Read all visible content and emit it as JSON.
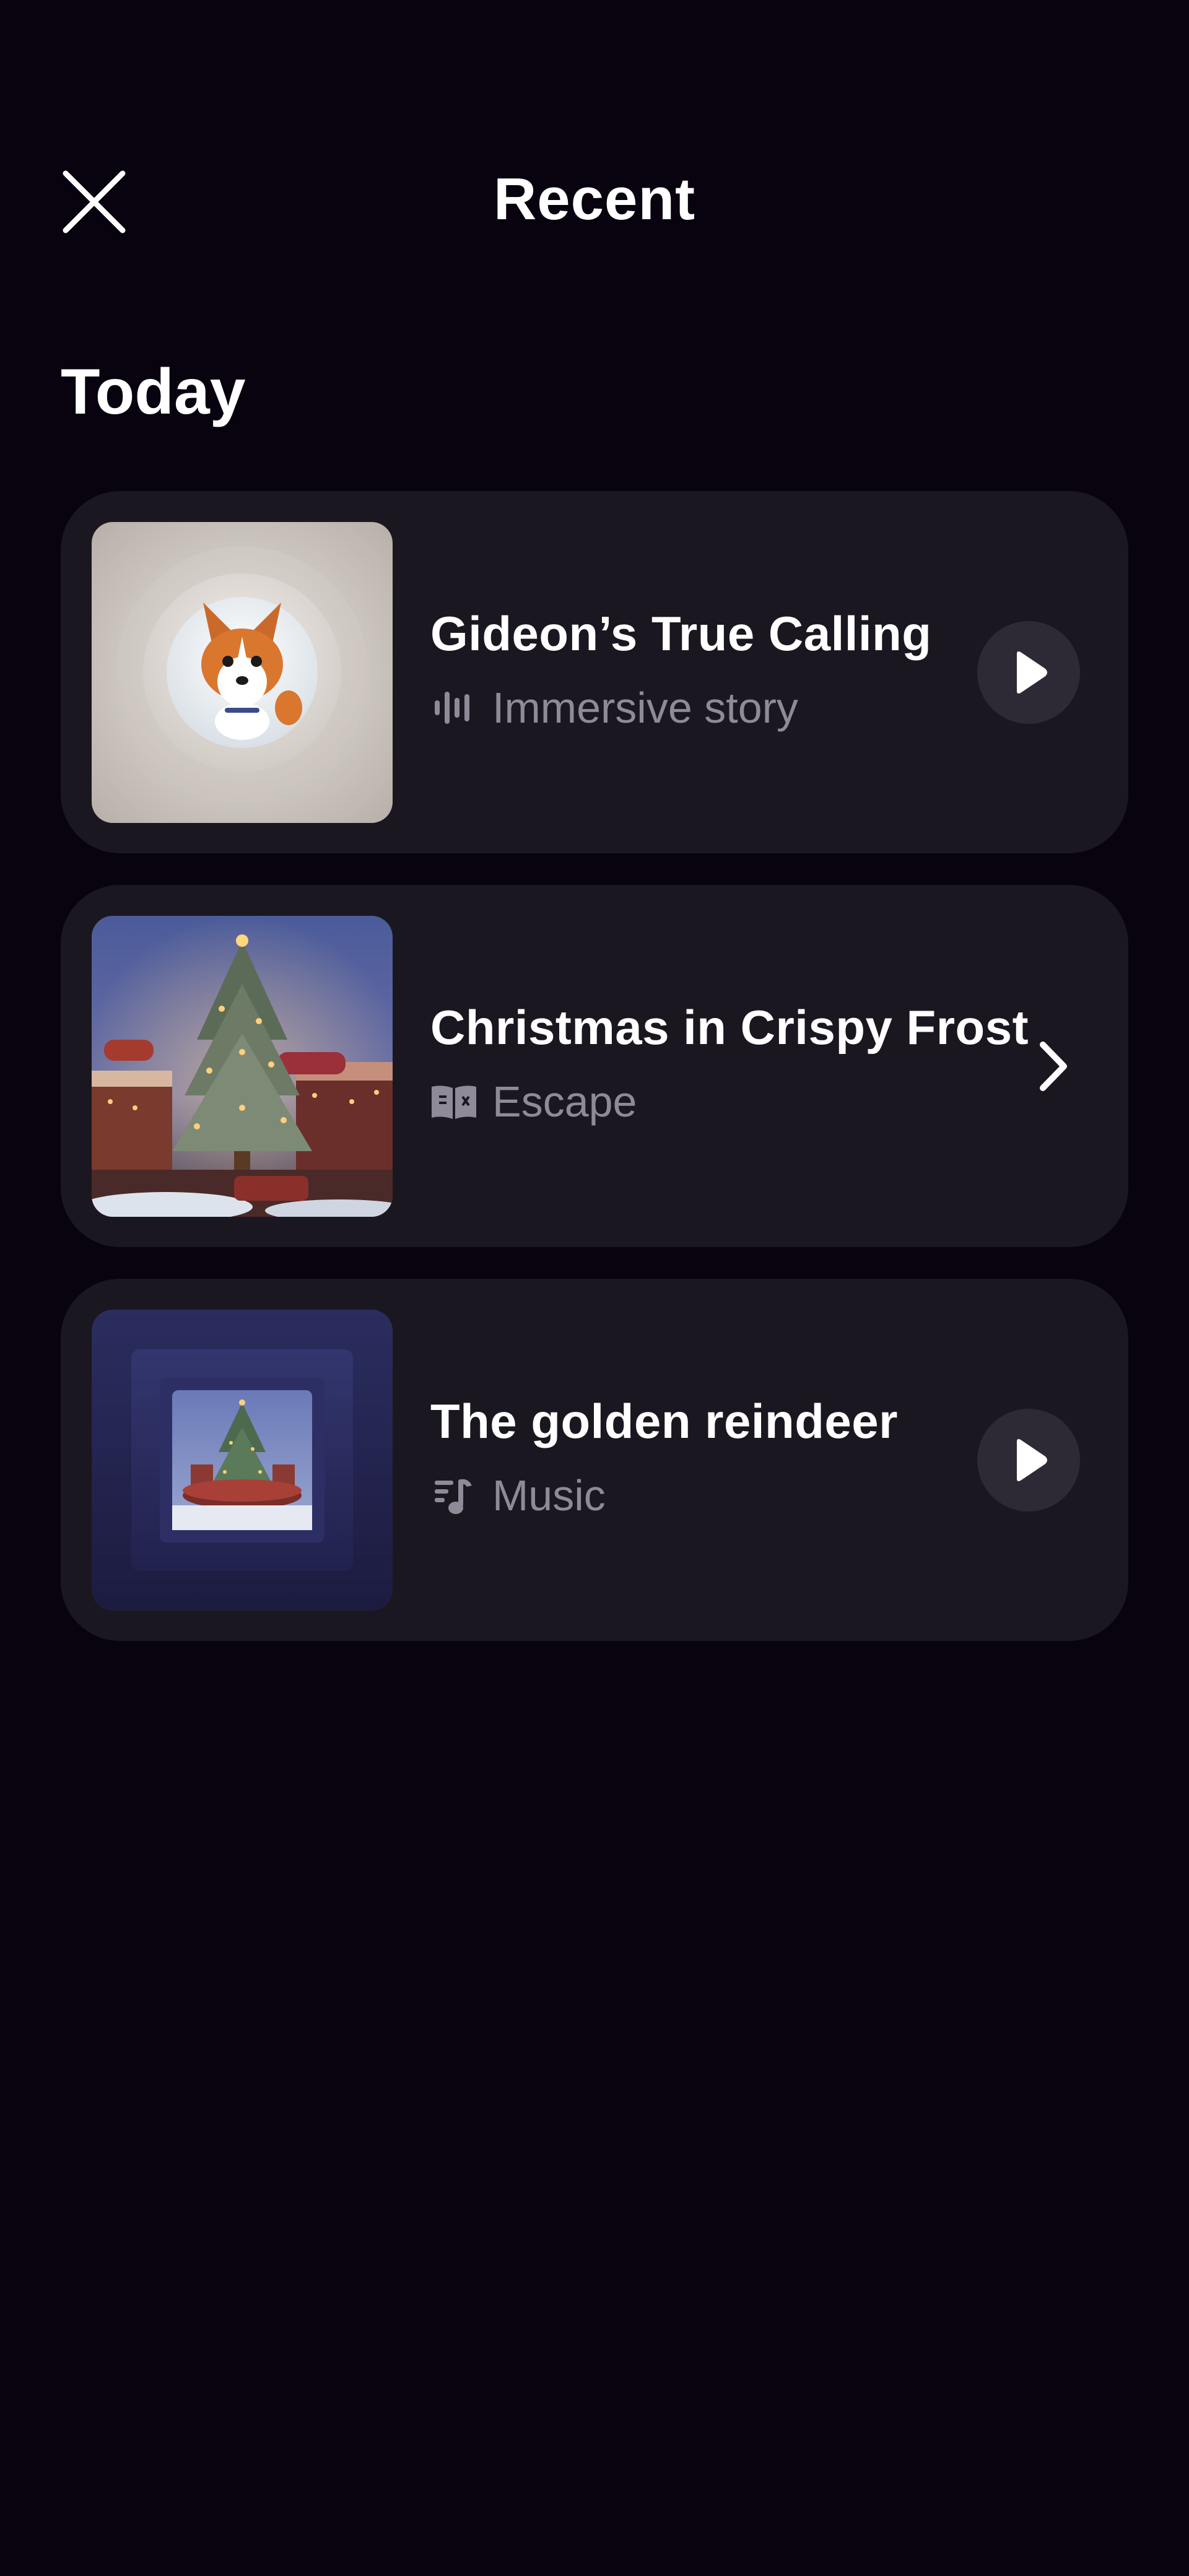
{
  "header": {
    "title": "Recent",
    "close_icon": "close-icon"
  },
  "sections": [
    {
      "heading": "Today",
      "items": [
        {
          "title": "Gideon’s True Calling",
          "type_label": "Immersive story",
          "type_icon": "audio-waveform-icon",
          "action": "play",
          "action_icon": "play-icon",
          "thumbnail": "corgi-dog-artwork"
        },
        {
          "title": "Christmas in Crispy Frost",
          "type_label": "Escape",
          "type_icon": "book-icon",
          "action": "open",
          "action_icon": "chevron-right-icon",
          "thumbnail": "christmas-market-tree-artwork"
        },
        {
          "title": "The golden reindeer",
          "type_label": "Music",
          "type_icon": "music-note-icon",
          "action": "play",
          "action_icon": "play-icon",
          "thumbnail": "christmas-tree-music-box-artwork"
        }
      ]
    }
  ],
  "colors": {
    "background": "#08030f",
    "card": "#1b1720",
    "play_button": "#2e2a35",
    "secondary_text": "#8f8a97",
    "primary_text": "#ffffff"
  }
}
